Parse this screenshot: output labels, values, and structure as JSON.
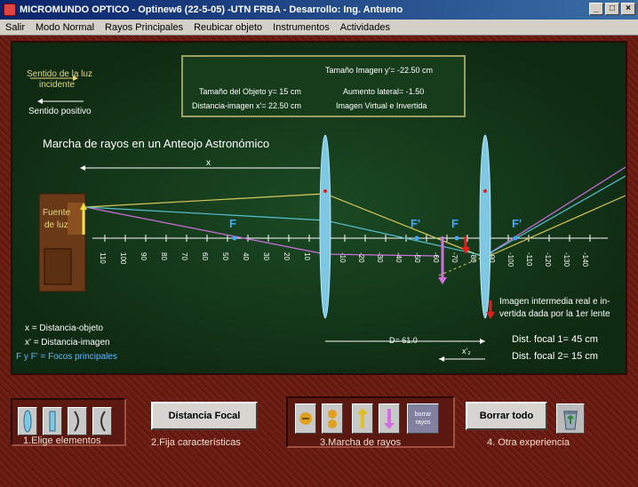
{
  "window": {
    "title": "MICROMUNDO OPTICO - Optinew6 (22-5-05) -UTN FRBA - Desarrollo: Ing. Antueno",
    "min_label": "_",
    "max_label": "□",
    "close_label": "×"
  },
  "menu": [
    "Salir",
    "Modo Normal",
    "Rayos Principales",
    "Reubicar objeto",
    "Instrumentos",
    "Actividades"
  ],
  "legend_top": {
    "light_dir_1": "Sentido de la luz",
    "light_dir_2": "incidente",
    "positive_dir": "Sentido positivo"
  },
  "info": {
    "image_size": "Tamaño Imagen y'= -22.50 cm",
    "object_size": "Tamaño del Objeto y= 15 cm",
    "magnification": "Aumento lateral= -1.50",
    "image_distance": "Distancia-imagen x'= 22.50 cm",
    "image_type": "Imagen Virtual e Invertida"
  },
  "diagram": {
    "title": "Marcha de rayos en un Anteojo Astronómico",
    "x_label": "x",
    "source_1": "Fuente",
    "source_2": "de luz",
    "focus_f": "F",
    "focus_fp": "F'",
    "ticks_left": [
      "110",
      "100",
      "90",
      "80",
      "70",
      "60",
      "50",
      "40",
      "30",
      "20",
      "10"
    ],
    "ticks_right": [
      "-10",
      "-20",
      "-30",
      "-40",
      "-50",
      "-60",
      "-70",
      "-80",
      "-90",
      "-100",
      "-110",
      "-120",
      "-130",
      "-140"
    ],
    "intermediate_1": "Imagen intermedia real e in-",
    "intermediate_2": "vertida dada por la 1er lente",
    "distance_d": "D= 61.0",
    "x2_label": "x'₂",
    "focal_1": "Dist. focal 1= 45 cm",
    "focal_2": "Dist. focal 2= 15 cm",
    "legend_x": "x   = Distancia-objeto",
    "legend_xp": "x'  = Distancia-imagen",
    "legend_f": "F y F' = Focos principales"
  },
  "toolbar": {
    "step1": "1.Elige elementos",
    "focal_button": "Distancia Focal",
    "step2": "2.Fija características",
    "step3": "3.Marcha de rayos",
    "borrar_rayos": "borrar rayos",
    "clear_button": "Borrar todo",
    "step4": "4. Otra experiencia"
  },
  "colors": {
    "lens": "#7ec8e3",
    "ray_pink": "#d070e0",
    "ray_yellow": "#d8c858",
    "ray_cyan": "#58c0d0",
    "focus": "#40a8ff",
    "arrow_red": "#e02020"
  }
}
